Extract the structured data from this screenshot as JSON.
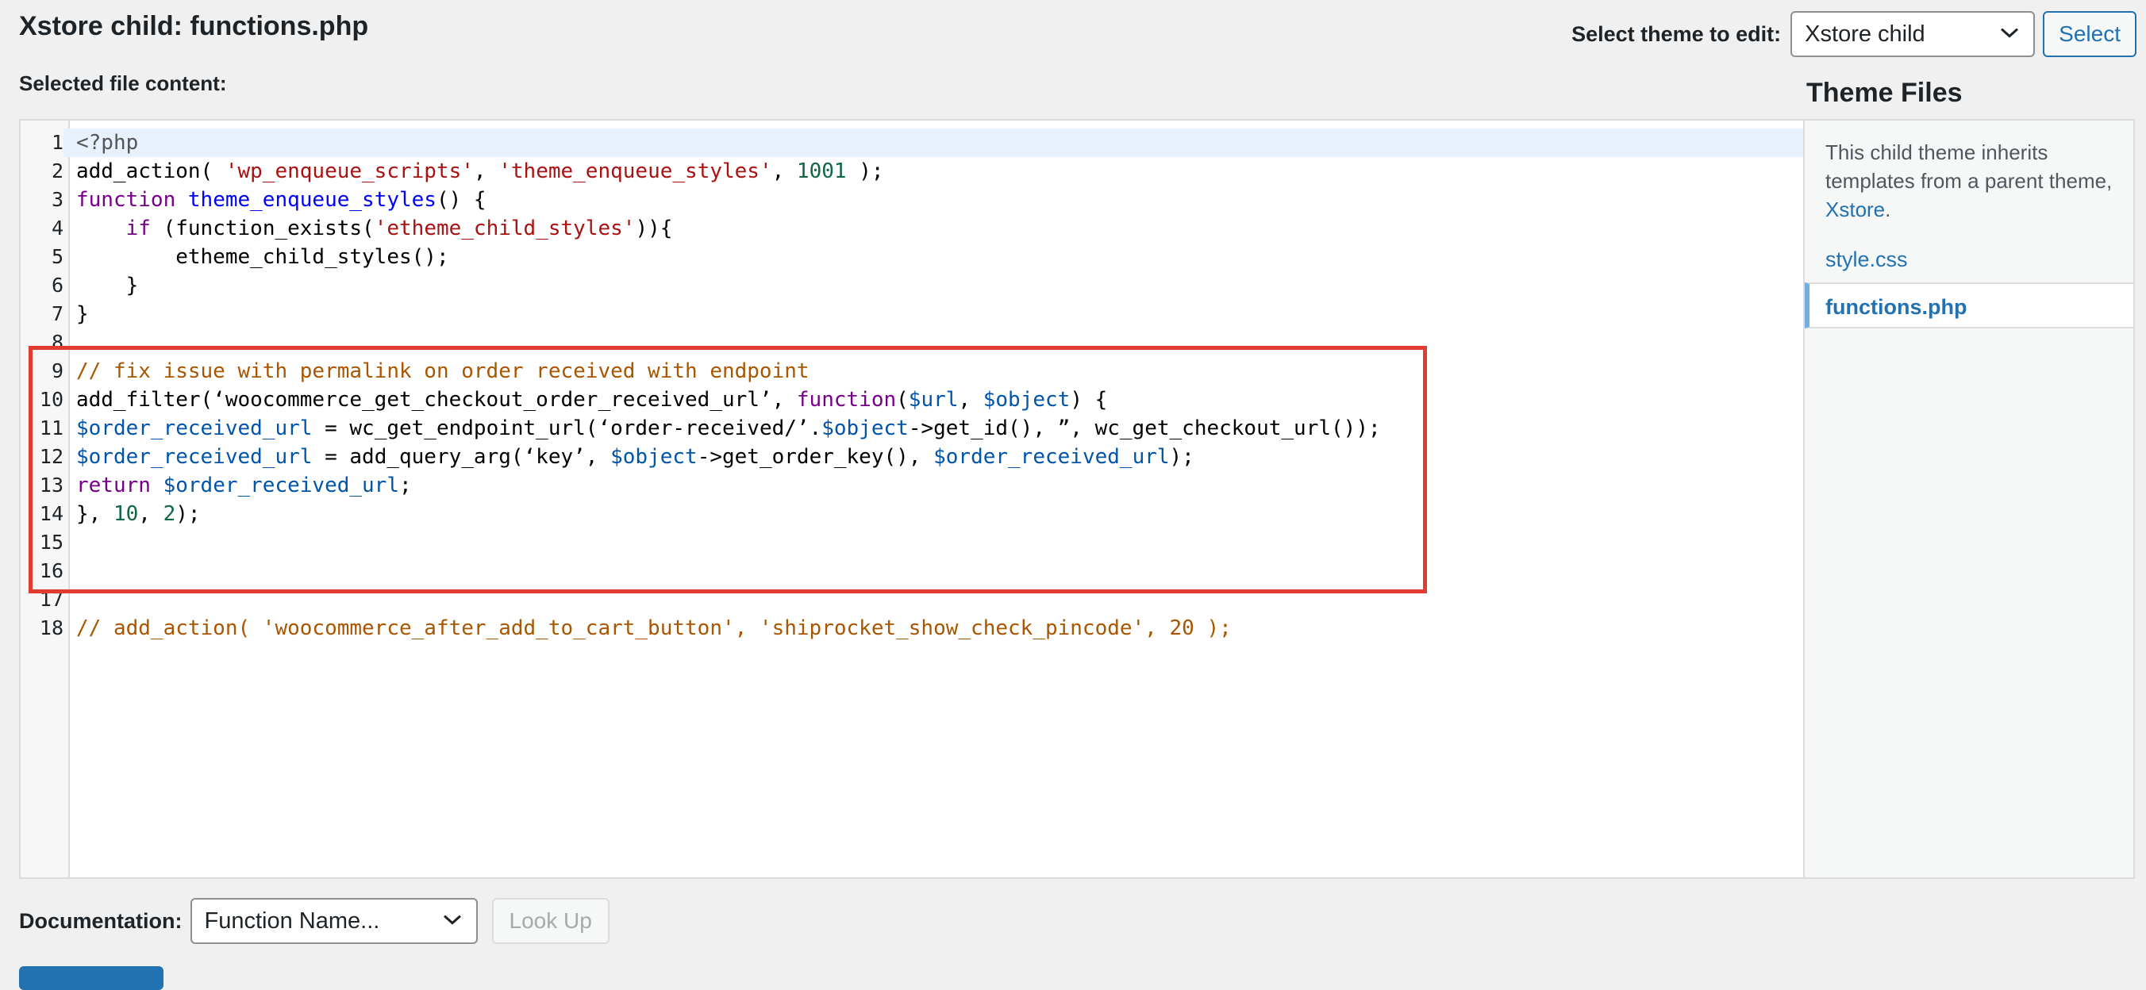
{
  "page": {
    "title": "Xstore child: functions.php",
    "selected_label": "Selected file content:"
  },
  "theme_select": {
    "label": "Select theme to edit:",
    "value": "Xstore child",
    "button": "Select"
  },
  "theme_files": {
    "title": "Theme Files",
    "note_prefix": "This child theme inherits templates from a parent theme,",
    "parent_link": "Xstore",
    "note_suffix": ".",
    "files": [
      {
        "label": "style.css",
        "current": false
      },
      {
        "label": "functions.php",
        "current": true
      }
    ]
  },
  "editor": {
    "lines": [
      [
        [
          "meta",
          "<?php"
        ]
      ],
      [
        [
          "plain",
          "add_action( "
        ],
        [
          "str",
          "'wp_enqueue_scripts'"
        ],
        [
          "plain",
          ", "
        ],
        [
          "str",
          "'theme_enqueue_styles'"
        ],
        [
          "plain",
          ", "
        ],
        [
          "num",
          "1001"
        ],
        [
          "plain",
          " );"
        ]
      ],
      [
        [
          "kw",
          "function"
        ],
        [
          "plain",
          " "
        ],
        [
          "def",
          "theme_enqueue_styles"
        ],
        [
          "plain",
          "() {"
        ]
      ],
      [
        [
          "plain",
          "    "
        ],
        [
          "kw",
          "if"
        ],
        [
          "plain",
          " (function_exists("
        ],
        [
          "str",
          "'etheme_child_styles'"
        ],
        [
          "plain",
          ")){"
        ]
      ],
      [
        [
          "plain",
          "        etheme_child_styles();"
        ]
      ],
      [
        [
          "plain",
          "    }"
        ]
      ],
      [
        [
          "plain",
          "}"
        ]
      ],
      [],
      [
        [
          "comment",
          "// fix issue with permalink on order received with endpoint"
        ]
      ],
      [
        [
          "plain",
          "add_filter(‘woocommerce_get_checkout_order_received_url’, "
        ],
        [
          "kw",
          "function"
        ],
        [
          "plain",
          "("
        ],
        [
          "var",
          "$url"
        ],
        [
          "plain",
          ", "
        ],
        [
          "var",
          "$object"
        ],
        [
          "plain",
          ") {"
        ]
      ],
      [
        [
          "var",
          "$order_received_url"
        ],
        [
          "plain",
          " = wc_get_endpoint_url(‘order-received/’."
        ],
        [
          "var",
          "$object"
        ],
        [
          "plain",
          "->get_id(), ”, wc_get_checkout_url());"
        ]
      ],
      [
        [
          "var",
          "$order_received_url"
        ],
        [
          "plain",
          " = add_query_arg(‘key’, "
        ],
        [
          "var",
          "$object"
        ],
        [
          "plain",
          "->get_order_key(), "
        ],
        [
          "var",
          "$order_received_url"
        ],
        [
          "plain",
          ");"
        ]
      ],
      [
        [
          "kw",
          "return"
        ],
        [
          "plain",
          " "
        ],
        [
          "var",
          "$order_received_url"
        ],
        [
          "plain",
          ";"
        ]
      ],
      [
        [
          "plain",
          "}, "
        ],
        [
          "num",
          "10"
        ],
        [
          "plain",
          ", "
        ],
        [
          "num",
          "2"
        ],
        [
          "plain",
          ");"
        ]
      ],
      [],
      [],
      [],
      [
        [
          "comment",
          "// add_action( 'woocommerce_after_add_to_cart_button', 'shiprocket_show_check_pincode', 20 );"
        ]
      ]
    ]
  },
  "documentation": {
    "label": "Documentation:",
    "select_value": "Function Name...",
    "lookup_button": "Look Up"
  },
  "colors": {
    "accent": "#2271b1",
    "highlight_border": "#e03c2f",
    "active_line": "#e8f2ff"
  },
  "icons": {
    "select_arrow": "chevron-down-icon"
  }
}
